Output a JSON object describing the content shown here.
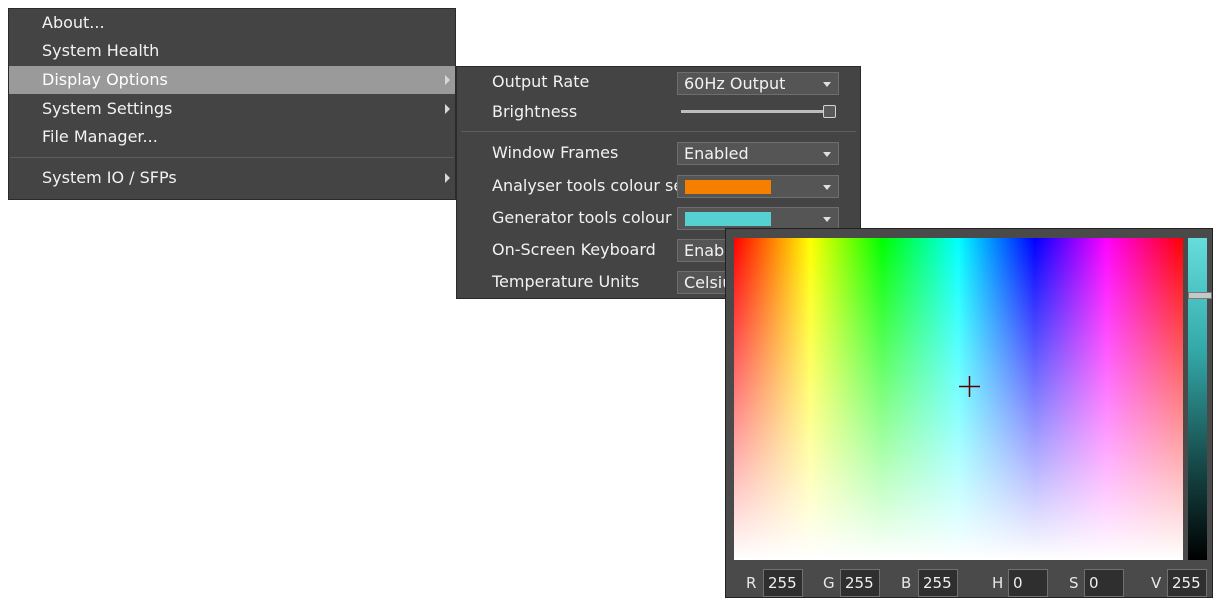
{
  "menu": {
    "items": [
      {
        "label": "About..."
      },
      {
        "label": "System Health"
      },
      {
        "label": "Display Options"
      },
      {
        "label": "System Settings"
      },
      {
        "label": "File Manager..."
      },
      {
        "label": "System IO / SFPs"
      }
    ]
  },
  "display_options": {
    "output_rate": {
      "label": "Output Rate",
      "value": "60Hz Output"
    },
    "brightness": {
      "label": "Brightness",
      "level_percent": 100
    },
    "window_frames": {
      "label": "Window Frames",
      "value": "Enabled"
    },
    "analyser_colour": {
      "label": "Analyser tools colour select",
      "color": "#f77f00"
    },
    "generator_colour": {
      "label": "Generator tools colour select",
      "color": "#56d1d1"
    },
    "keyboard": {
      "label": "On-Screen Keyboard",
      "value": "Enabl"
    },
    "temperature": {
      "label": "Temperature Units",
      "value": "Celsiu"
    }
  },
  "color_picker": {
    "fields": [
      {
        "label": "R",
        "value": "255"
      },
      {
        "label": "G",
        "value": "255"
      },
      {
        "label": "B",
        "value": "255"
      },
      {
        "label": "H",
        "value": "0"
      },
      {
        "label": "S",
        "value": "0"
      },
      {
        "label": "V",
        "value": "255"
      }
    ]
  },
  "colors": {
    "panel": "#444444",
    "highlight": "#9a9a9a",
    "text": "#f2f2f2"
  }
}
